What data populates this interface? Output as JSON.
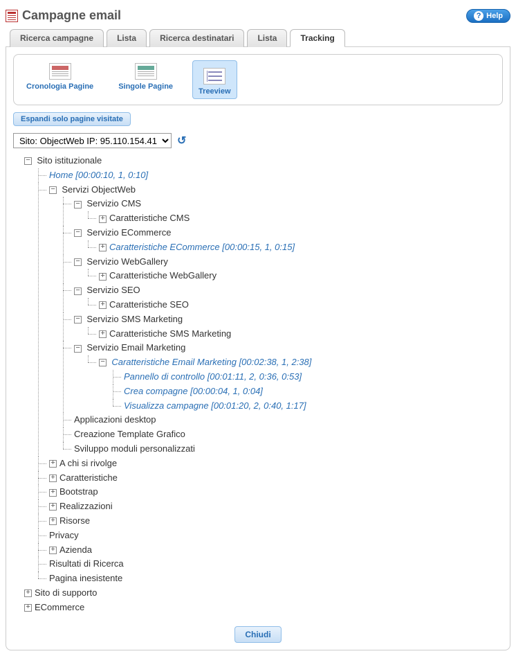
{
  "header": {
    "title": "Campagne email",
    "help_label": "Help"
  },
  "tabs": [
    {
      "label": "Ricerca campagne",
      "active": false
    },
    {
      "label": "Lista",
      "active": false
    },
    {
      "label": "Ricerca destinatari",
      "active": false
    },
    {
      "label": "Lista",
      "active": false
    },
    {
      "label": "Tracking",
      "active": true
    }
  ],
  "toolbar": {
    "items": [
      {
        "label": "Cronologia Pagine",
        "selected": false
      },
      {
        "label": "Singole Pagine",
        "selected": false
      },
      {
        "label": "Treeview",
        "selected": true
      }
    ]
  },
  "controls": {
    "expand_button": "Espandi solo pagine visitate",
    "site_select": "Sito: ObjectWeb    IP: 95.110.154.41"
  },
  "tree": {
    "root_label": "Sito istituzionale",
    "home": "Home [00:00:10, 1, 0:10]",
    "servizi": "Servizi ObjectWeb",
    "cms": "Servizio CMS",
    "cms_car": "Caratteristiche CMS",
    "ecom": "Servizio ECommerce",
    "ecom_car": "Caratteristiche ECommerce [00:00:15, 1, 0:15]",
    "webg": "Servizio WebGallery",
    "webg_car": "Caratteristiche WebGallery",
    "seo": "Servizio SEO",
    "seo_car": "Caratteristiche SEO",
    "sms": "Servizio SMS Marketing",
    "sms_car": "Caratteristiche SMS Marketing",
    "email": "Servizio Email Marketing",
    "email_car": "Caratteristiche Email Marketing [00:02:38, 1, 2:38]",
    "email_pan": "Pannello di controllo [00:01:11, 2, 0:36, 0:53]",
    "email_crea": "Crea compagne [00:00:04, 1, 0:04]",
    "email_vis": "Visualizza campagne [00:01:20, 2, 0:40, 1:17]",
    "app_desktop": "Applicazioni desktop",
    "template": "Creazione Template Grafico",
    "moduli": "Sviluppo moduli personalizzati",
    "achi": "A chi si rivolge",
    "carat": "Caratteristiche",
    "boot": "Bootstrap",
    "real": "Realizzazioni",
    "risorse": "Risorse",
    "privacy": "Privacy",
    "azienda": "Azienda",
    "ricerca": "Risultati di Ricerca",
    "inesistente": "Pagina inesistente",
    "supporto": "Sito di supporto",
    "ecommerce_site": "ECommerce"
  },
  "footer": {
    "close_label": "Chiudi"
  }
}
